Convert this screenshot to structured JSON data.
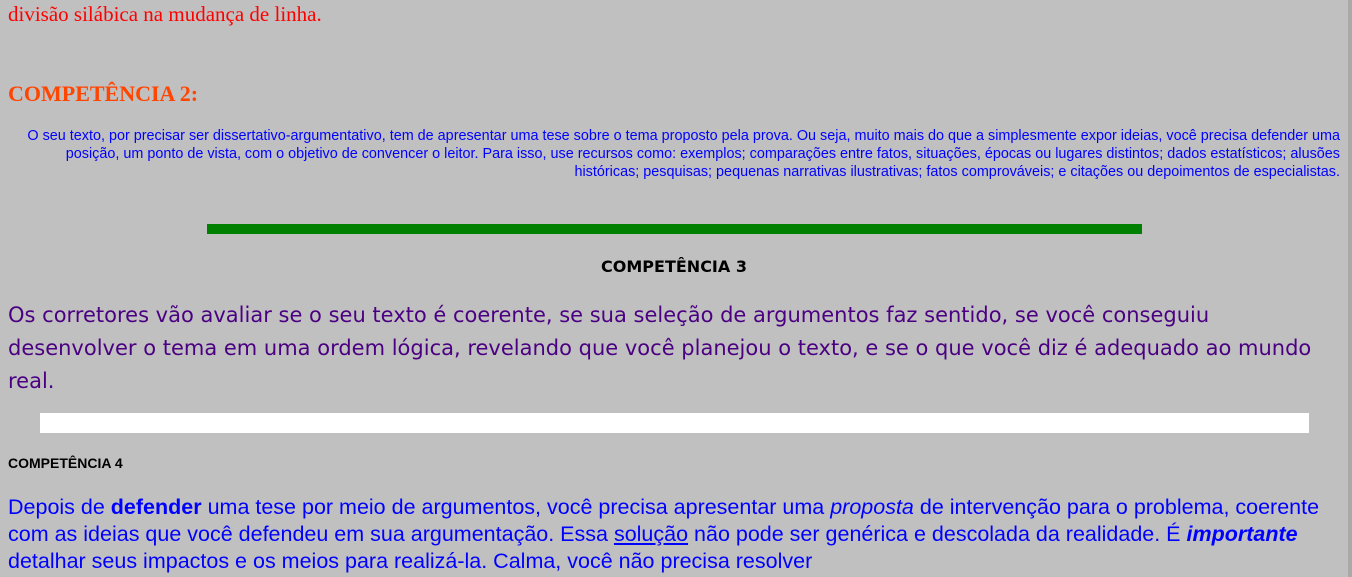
{
  "intro_tail": "divisão silábica na mudança de linha.",
  "competencia2": {
    "title": "COMPETÊNCIA 2:",
    "text": "O seu texto, por precisar ser dissertativo-argumentativo, tem de apresentar uma tese sobre o tema proposto pela prova. Ou seja, muito mais do que a simplesmente expor ideias, você precisa defender uma posição, um ponto de vista, com o objetivo de convencer o leitor. Para isso, use recursos como: exemplos; comparações entre fatos, situações, épocas ou lugares distintos; dados estatísticos; alusões históricas; pesquisas; pequenas narrativas ilustrativas; fatos comprováveis; e citações ou depoimentos de especialistas."
  },
  "competencia3": {
    "title": "COMPETÊNCIA 3",
    "text": "Os corretores vão avaliar se o seu texto é coerente, se sua seleção de argumentos faz sentido, se você conseguiu desenvolver o tema em uma ordem lógica, revelando que você planejou o texto, e se o que você diz é adequado ao mundo real."
  },
  "competencia4": {
    "title": "COMPETÊNCIA 4",
    "t1": "Depois de ",
    "b1": "defender",
    "t2": " uma tese por meio de argumentos, você precisa apresentar uma ",
    "i1": "proposta",
    "t3": " de intervenção para o problema, coerente com as ideias que você defendeu em sua argumentação. Essa ",
    "u1": "solução",
    "t4": " não pode ser genérica e descolada da realidade. É ",
    "bi1": "importante",
    "t5": " detalhar seus impactos e os meios para realizá-la. Calma, você não precisa resolver"
  },
  "colors": {
    "background": "#c0c0c0",
    "intro": "#ff0000",
    "c2_title": "#ff4500",
    "c2_text": "#0000ff",
    "divider1": "#008000",
    "c3_text": "#4b0082",
    "divider2": "#ffffff",
    "c4_text": "#0000ff"
  }
}
